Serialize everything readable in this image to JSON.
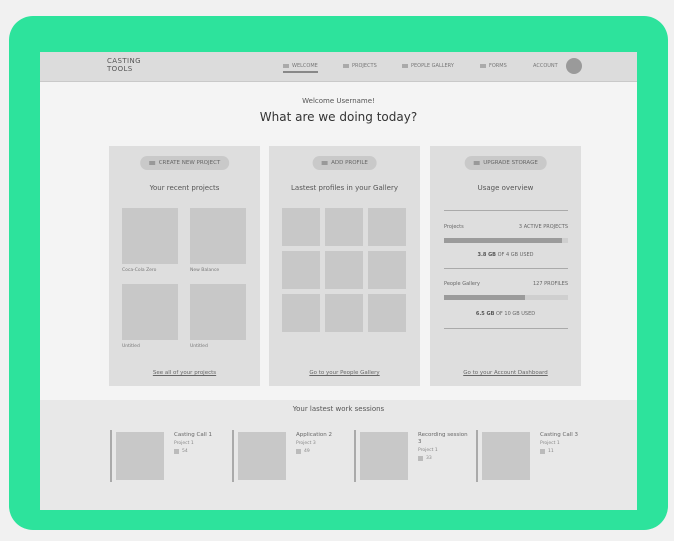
{
  "app": {
    "logo_line1": "CASTING",
    "logo_line2": "TOOLS"
  },
  "nav": {
    "items": [
      {
        "label": "WELCOME",
        "active": true
      },
      {
        "label": "PROJECTS",
        "active": false
      },
      {
        "label": "PEOPLE GALLERY",
        "active": false
      },
      {
        "label": "FORMS",
        "active": false
      }
    ],
    "account": "ACCOUNT"
  },
  "greeting": "Welcome Username!",
  "headline": "What are we doing today?",
  "projects_card": {
    "button": "CREATE NEW PROJECT",
    "title": "Your recent projects",
    "items": [
      "Coca-Cola Zero",
      "New Balance",
      "Untitled",
      "Untitled"
    ],
    "link": "See all of your projects"
  },
  "profiles_card": {
    "button": "ADD PROFILE",
    "title": "Lastest profiles in your Gallery",
    "link": "Go to your People Gallery"
  },
  "storage_card": {
    "button": "UPGRADE STORAGE",
    "title": "Usage overview",
    "projects": {
      "label": "Projects",
      "meta": "3 ACTIVE PROJECTS",
      "used": "3.8 GB",
      "rest": "OF 4 GB USED",
      "fraction": 0.95
    },
    "gallery": {
      "label": "People Gallery",
      "meta": "127 PROFILES",
      "used": "6.5 GB",
      "rest": "OF 10 GB USED",
      "fraction": 0.65
    },
    "link": "Go to your Account Dashboard"
  },
  "sessions": {
    "title": "Your lastest work sessions",
    "items": [
      {
        "name": "Casting Call 1",
        "project": "Project 1",
        "count": "54"
      },
      {
        "name": "Application 2",
        "project": "Project 3",
        "count": "49"
      },
      {
        "name": "Recording session 3",
        "project": "Project 1",
        "count": "33"
      },
      {
        "name": "Casting Call 3",
        "project": "Project 1",
        "count": "11"
      }
    ]
  }
}
